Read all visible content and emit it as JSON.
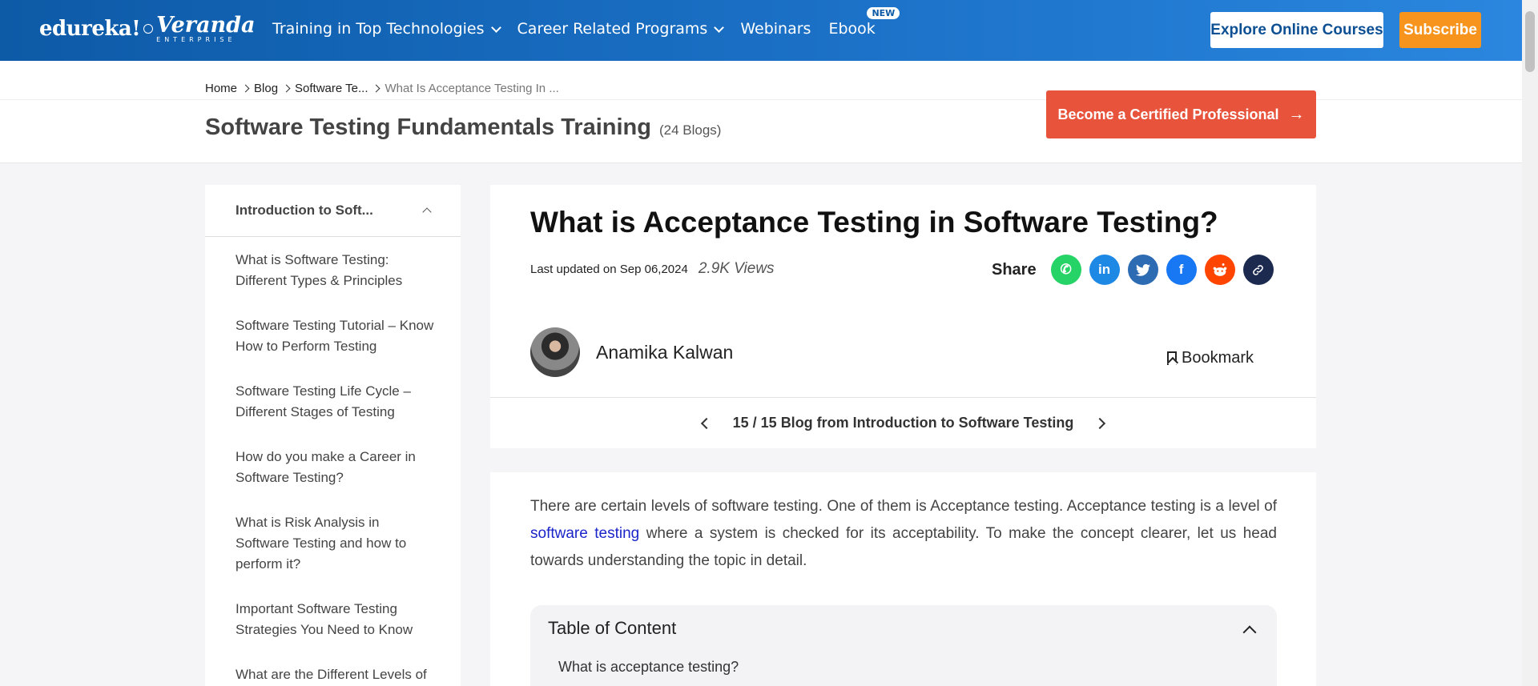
{
  "nav": {
    "logo_brand": "edureka!",
    "logo_veranda": "Veranda",
    "logo_enterprise": "ENTERPRISE",
    "links": [
      {
        "label": "Training in Top Technologies"
      },
      {
        "label": "Career Related Programs"
      },
      {
        "label": "Webinars"
      },
      {
        "label": "Ebook"
      }
    ],
    "new_badge": "NEW",
    "explore_label": "Explore Online Courses",
    "subscribe_label": "Subscribe"
  },
  "breadcrumb": {
    "home": "Home",
    "blog": "Blog",
    "category": "Software Te...",
    "current": "What Is Acceptance Testing In ..."
  },
  "header": {
    "course_title": "Software Testing Fundamentals Training",
    "blog_count": "(24 Blogs)",
    "certified_label": "Become a Certified Professional",
    "certified_arrow": "→"
  },
  "sidebar": {
    "section_title": "Introduction to Soft...",
    "items": [
      "What is Software Testing: Different Types & Principles",
      "Software Testing Tutorial – Know How to Perform Testing",
      "Software Testing Life Cycle – Different Stages of Testing",
      "How do you make a Career in Software Testing?",
      "What is Risk Analysis in Software Testing and how to perform it?",
      "Important Software Testing Strategies You Need to Know",
      "What are the Different Levels of Software Testing?"
    ]
  },
  "article": {
    "title": "What is Acceptance Testing in Software Testing?",
    "updated": "Last updated on Sep 06,2024",
    "views": "2.9K Views",
    "share_label": "Share",
    "author": "Anamika Kalwan",
    "bookmark_label": "Bookmark",
    "pager_text": "15 / 15 Blog from Introduction to Software Testing",
    "intro_part1": "There are certain levels of software testing. One of them is Acceptance testing. Acceptance testing is a level of ",
    "intro_link": "software testing",
    "intro_part2": " where a system is checked for its acceptability. To make the concept clearer, let us head towards understanding the topic in detail.",
    "toc_title": "Table of Content",
    "toc_first_item": "What is acceptance testing?"
  },
  "share_icons": [
    {
      "name": "whatsapp",
      "color": "#25d366",
      "glyph": "✆"
    },
    {
      "name": "linkedin",
      "color": "#1e88e5",
      "glyph": "in"
    },
    {
      "name": "twitter",
      "color": "#2d6bb3",
      "glyph": "🐦"
    },
    {
      "name": "facebook",
      "color": "#1877f2",
      "glyph": "f"
    },
    {
      "name": "reddit",
      "color": "#ff4500",
      "glyph": "◉"
    },
    {
      "name": "copy-link",
      "color": "#1b2a4e",
      "glyph": "🔗"
    }
  ],
  "colors": {
    "nav_gradient_start": "#0d5aa7",
    "subscribe": "#f7941d",
    "certified": "#e8533c",
    "link": "#1a25c9"
  }
}
